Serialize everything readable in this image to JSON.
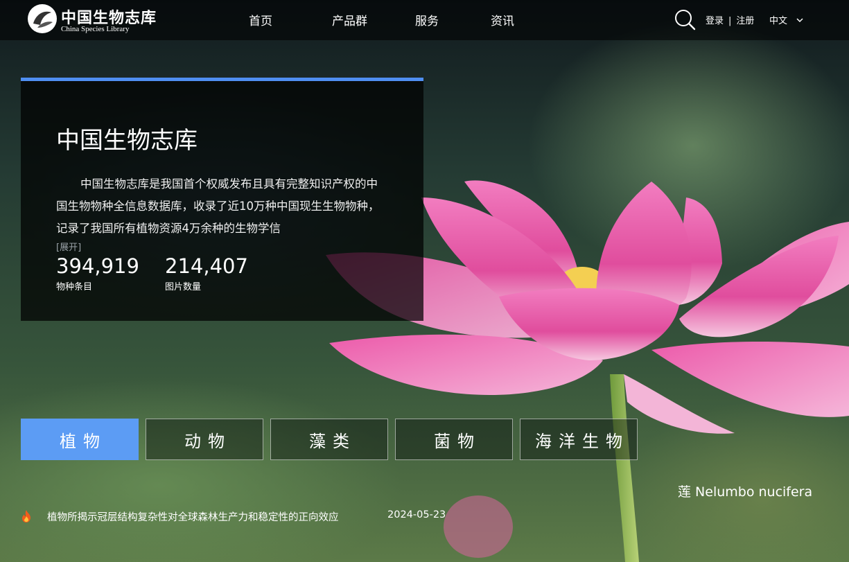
{
  "brand": {
    "name_cn": "中国生物志库",
    "name_en": "China Species Library"
  },
  "nav": {
    "items": [
      {
        "label": "首页"
      },
      {
        "label": "产品群"
      },
      {
        "label": "服务"
      },
      {
        "label": "资讯"
      }
    ]
  },
  "header": {
    "login": "登录",
    "separator": "|",
    "register": "注册",
    "language": "中文"
  },
  "intro": {
    "title": "中国生物志库",
    "description": "中国生物志库是我国首个权威发布且具有完整知识产权的中国生物物种全信息数据库，收录了近10万种中国现生生物物种，记录了我国所有植物资源4万余种的生物学信",
    "expand_label": "[展开]",
    "stats": [
      {
        "value": "394,919",
        "label": "物种条目"
      },
      {
        "value": "214,407",
        "label": "图片数量"
      }
    ]
  },
  "categories": [
    {
      "label": "植物",
      "active": true
    },
    {
      "label": "动物",
      "active": false
    },
    {
      "label": "藻类",
      "active": false
    },
    {
      "label": "菌物",
      "active": false
    },
    {
      "label": "海洋生物",
      "active": false
    }
  ],
  "photo_caption": "莲 Nelumbo nucifera",
  "news": {
    "title": "植物所揭示冠层结构复杂性对全球森林生产力和稳定性的正向效应",
    "date": "2024-05-23"
  },
  "colors": {
    "accent": "#4f8ff2",
    "active_button": "#5c9cf4",
    "lotus": "#e45aa6"
  },
  "icons": {
    "search": "search-icon",
    "dropdown": "chevron-down-icon",
    "news": "fire-icon"
  }
}
